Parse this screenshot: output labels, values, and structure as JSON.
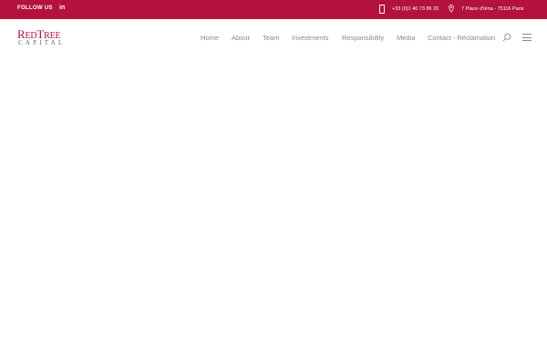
{
  "topbar": {
    "follow_label": "FOLLOW US",
    "social": "in",
    "phone": "+33 (0)1 40 73 86 20",
    "address": "7 Place d'Iéna - 75116 Paris",
    "background": "#b4123c"
  },
  "logo": {
    "part1_big": "R",
    "part1_small": "ED",
    "part2_big": "T",
    "part2_small": "REE",
    "line2": "CAPITAL"
  },
  "nav": {
    "items": [
      "Home",
      "About",
      "Team",
      "Investments",
      "Responsibility",
      "Media",
      "Contact - Réclamation"
    ]
  },
  "icons": {
    "search": "search-icon",
    "menu": "hamburger-menu-icon",
    "phone": "phone-icon",
    "location": "location-pin-icon"
  }
}
